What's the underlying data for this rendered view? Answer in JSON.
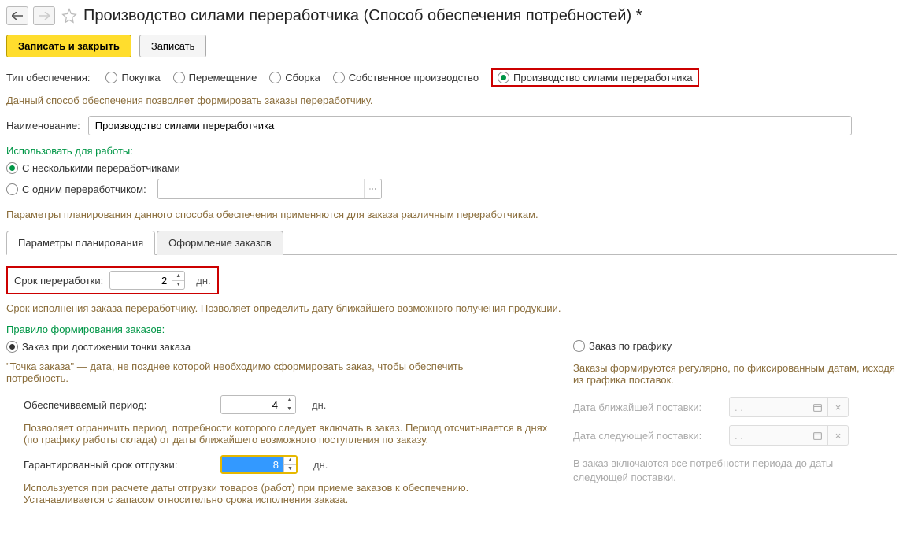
{
  "header": {
    "title": "Производство силами переработчика (Способ обеспечения потребностей) *"
  },
  "buttons": {
    "save_close": "Записать и закрыть",
    "save": "Записать"
  },
  "supplyType": {
    "label": "Тип обеспечения:",
    "options": {
      "purchase": "Покупка",
      "move": "Перемещение",
      "assembly": "Сборка",
      "own": "Собственное производство",
      "processor": "Производство силами переработчика"
    }
  },
  "description1": "Данный способ обеспечения позволяет формировать заказы переработчику.",
  "nameField": {
    "label": "Наименование:",
    "value": "Производство силами переработчика"
  },
  "useFor": {
    "heading": "Использовать для работы:",
    "multi": "С несколькими переработчиками",
    "single": "С одним переработчиком:"
  },
  "description2": "Параметры планирования данного способа обеспечения применяются для заказа различным переработчикам.",
  "tabs": {
    "planning": "Параметры планирования",
    "orders": "Оформление заказов"
  },
  "processingTime": {
    "label": "Срок переработки:",
    "value": "2",
    "unit": "дн.",
    "desc": "Срок исполнения заказа переработчику. Позволяет определить дату ближайшего возможного получения продукции."
  },
  "orderRule": {
    "heading": "Правило формирования заказов:",
    "point": "Заказ при достижении точки заказа",
    "point_desc": "\"Точка заказа\" — дата, не позднее которой необходимо сформировать заказ, чтобы обеспечить потребность.",
    "schedule": "Заказ по графику",
    "schedule_desc": "Заказы формируются регулярно, по фиксированным датам, исходя из графика поставок."
  },
  "providedPeriod": {
    "label": "Обеспечиваемый период:",
    "value": "4",
    "unit": "дн.",
    "desc": "Позволяет ограничить период, потребности которого следует включать в заказ. Период отсчитывается в днях (по графику работы склада) от даты ближайшего возможного поступления по заказу."
  },
  "guaranteedShip": {
    "label": "Гарантированный срок отгрузки:",
    "value": "8",
    "unit": "дн.",
    "desc": "Используется при расчете даты отгрузки товаров (работ) при приеме заказов к обеспечению. Устанавливается с запасом относительно срока исполнения заказа."
  },
  "dates": {
    "nearest_label": "Дата ближайшей поставки:",
    "next_label": "Дата следующей поставки:",
    "placeholder": ".  .",
    "desc": "В заказ включаются все потребности периода до даты следующей поставки."
  }
}
